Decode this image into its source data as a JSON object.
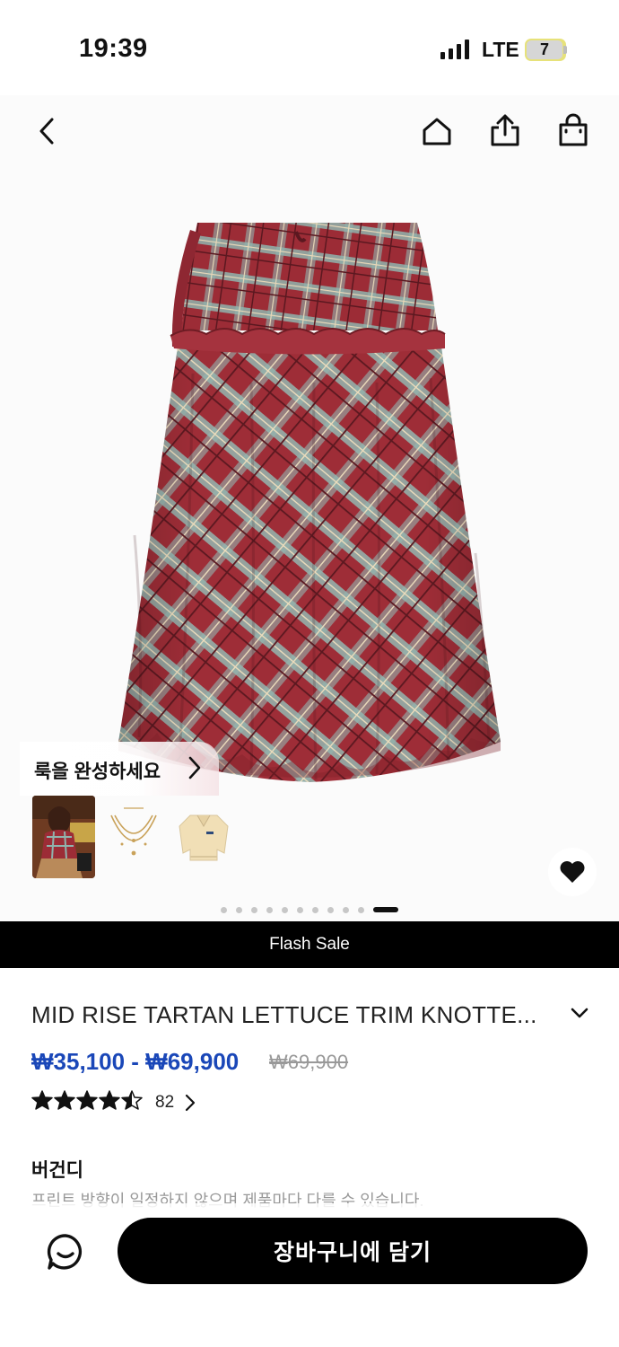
{
  "status_bar": {
    "time": "19:39",
    "network": "LTE",
    "battery": "7"
  },
  "gallery": {
    "nav_icons": [
      "back-icon",
      "home-icon",
      "share-icon",
      "shopping-bag-icon"
    ],
    "complete_look": {
      "title": "룩을 완성하세요",
      "thumbnails": [
        "model-photo",
        "gold-necklace",
        "cream-knit-sweater"
      ]
    },
    "pagination": {
      "total": 11,
      "active_index": 10
    },
    "wishlist_icon": "heart-icon"
  },
  "flash_banner": {
    "label": "Flash Sale"
  },
  "product": {
    "title": "MID RISE TARTAN LETTUCE TRIM KNOTTE...",
    "price_range": "₩35,100 - ₩69,900",
    "original_price": "₩69,900",
    "rating": 4.5,
    "review_count": "82",
    "color_name": "버건디",
    "color_note": "프린트 방향이 일정하지 않으며 제품마다 다를 수 있습니다."
  },
  "bottom_bar": {
    "chat_icon": "chat-icon",
    "add_to_cart_label": "장바구니에 담기"
  },
  "colors": {
    "price_accent": "#1a47b8",
    "banner_bg": "#000000",
    "plaid_red": "#9c2c36",
    "plaid_teal": "#8fb3ad"
  }
}
